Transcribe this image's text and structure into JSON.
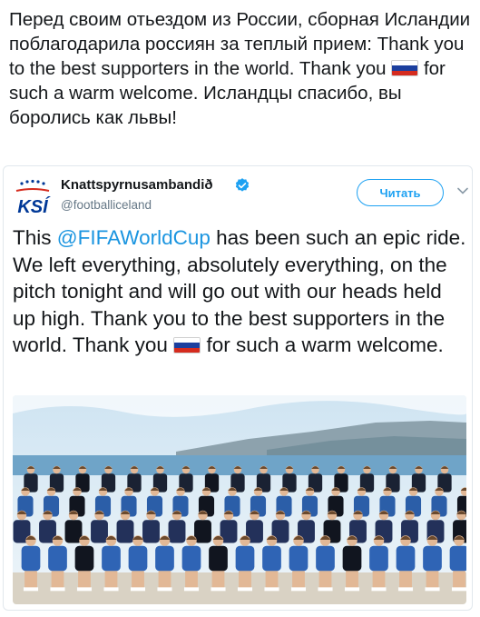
{
  "outer_post": {
    "text_before_flag": "Перед своим отьездом из России, сборная Исландии поблагодарила россиян за теплый прием: Thank you to the best supporters in the world. Thank you ",
    "text_after_flag": " for such a warm welcome. Исландцы спасибо, вы боролись как львы!",
    "flag_icon": "russian-flag-icon"
  },
  "tweet": {
    "author_name": "Knattspyrnusambandið",
    "handle": "@footballiceland",
    "follow_label": "Читать",
    "logo_text": "KSÍ",
    "text_start": "This ",
    "mention": "@FIFAWorldCup",
    "text_middle": " has been such an epic ride. We left everything, absolutely everything, on the pitch tonight and will go out with our heads held up high. Thank you to the best supporters in the world. Thank you ",
    "text_end": " for such a warm welcome.",
    "flag_icon": "russian-flag-icon",
    "verified_icon": "verified-badge-icon",
    "menu_icon": "chevron-down-icon",
    "photo": "team-photo"
  },
  "colors": {
    "link": "#1b95e0",
    "follow": "#1da1f2",
    "ksi_blue": "#003897",
    "flag_white": "#ffffff",
    "flag_blue": "#1c3f9e",
    "flag_red": "#d52b1e"
  }
}
